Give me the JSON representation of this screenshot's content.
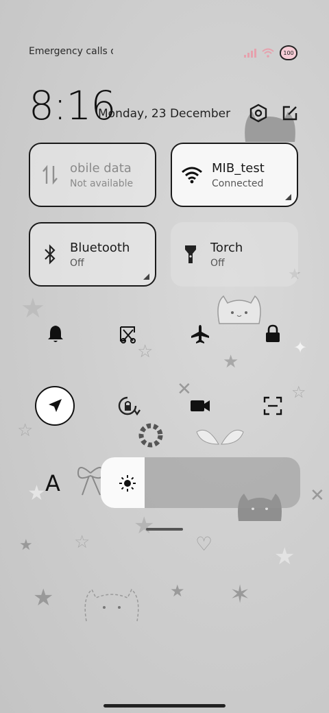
{
  "status_bar": {
    "left_text": "Emergency calls o",
    "battery_level": "100",
    "signal_icon": "signal-icon",
    "wifi_icon": "wifi-icon"
  },
  "clock": {
    "time": "8:16",
    "date": "Monday, 23 December"
  },
  "header_actions": {
    "settings_icon": "gear-icon",
    "edit_icon": "edit-icon"
  },
  "tiles": {
    "mobile_data": {
      "name": "obile data",
      "status": "Not available"
    },
    "wifi": {
      "name": "MIB_test",
      "status": "Connected"
    },
    "bluetooth": {
      "name": "Bluetooth",
      "status": "Off"
    },
    "torch": {
      "name": "Torch",
      "status": "Off"
    }
  },
  "quick_toggles_row1": [
    "bell-icon",
    "screenshot-icon",
    "airplane-icon",
    "lock-icon"
  ],
  "quick_toggles_row2": [
    "location-icon",
    "rotation-lock-icon",
    "video-icon",
    "scan-icon"
  ],
  "brightness": {
    "auto_brightness_label": "A",
    "level_fraction": 0.22
  },
  "colors": {
    "accent": "#1a1a1a",
    "tile_active": "#f7f7f7",
    "background": "#cfcfcf",
    "signal_pink": "#e6a1ad"
  }
}
